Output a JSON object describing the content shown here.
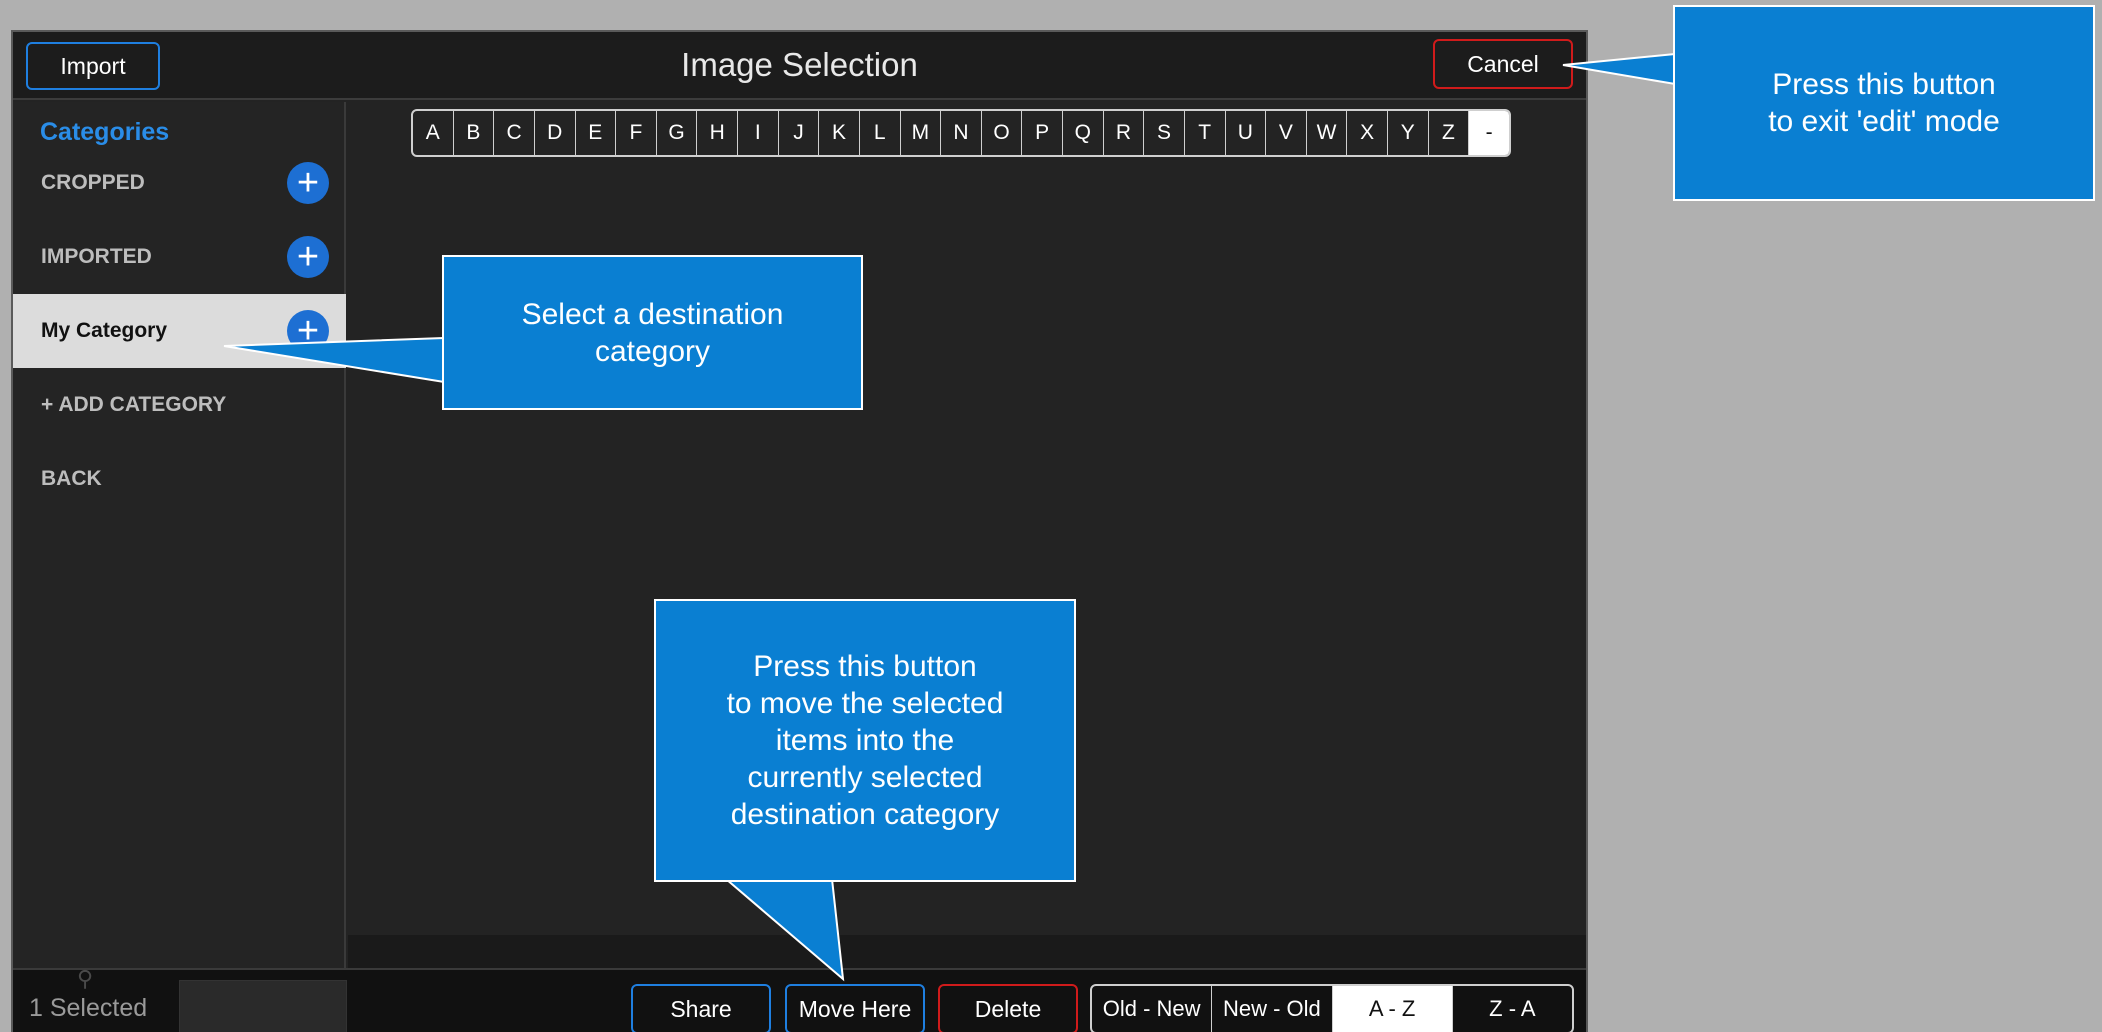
{
  "header": {
    "title": "Image Selection",
    "import_label": "Import",
    "cancel_label": "Cancel"
  },
  "sidebar": {
    "header": "Categories",
    "items": [
      {
        "label": "CROPPED",
        "add": "+"
      },
      {
        "label": "IMPORTED",
        "add": "+"
      },
      {
        "label": "My Category",
        "add": "+"
      },
      {
        "label": "+ ADD CATEGORY"
      },
      {
        "label": "BACK"
      }
    ]
  },
  "alphabet": [
    "A",
    "B",
    "C",
    "D",
    "E",
    "F",
    "G",
    "H",
    "I",
    "J",
    "K",
    "L",
    "M",
    "N",
    "O",
    "P",
    "Q",
    "R",
    "S",
    "T",
    "U",
    "V",
    "W",
    "X",
    "Y",
    "Z",
    "-"
  ],
  "footer": {
    "selected_count": "1 Selected",
    "share_label": "Share",
    "move_label": "Move Here",
    "delete_label": "Delete",
    "sort_options": [
      "Old - New",
      "New - Old",
      "A - Z",
      "Z - A"
    ],
    "sort_selected": "A - Z"
  },
  "callouts": {
    "exit_edit": [
      "Press this button",
      "to exit 'edit' mode"
    ],
    "destination": [
      "Select a destination",
      "category"
    ],
    "move_here": [
      "Press this button",
      "to move the selected",
      "items into the",
      "currently selected",
      "destination category"
    ]
  },
  "colors": {
    "accent_blue": "#1f7fe0",
    "danger_red": "#d01b1b",
    "callout_blue": "#0a7fd2"
  }
}
